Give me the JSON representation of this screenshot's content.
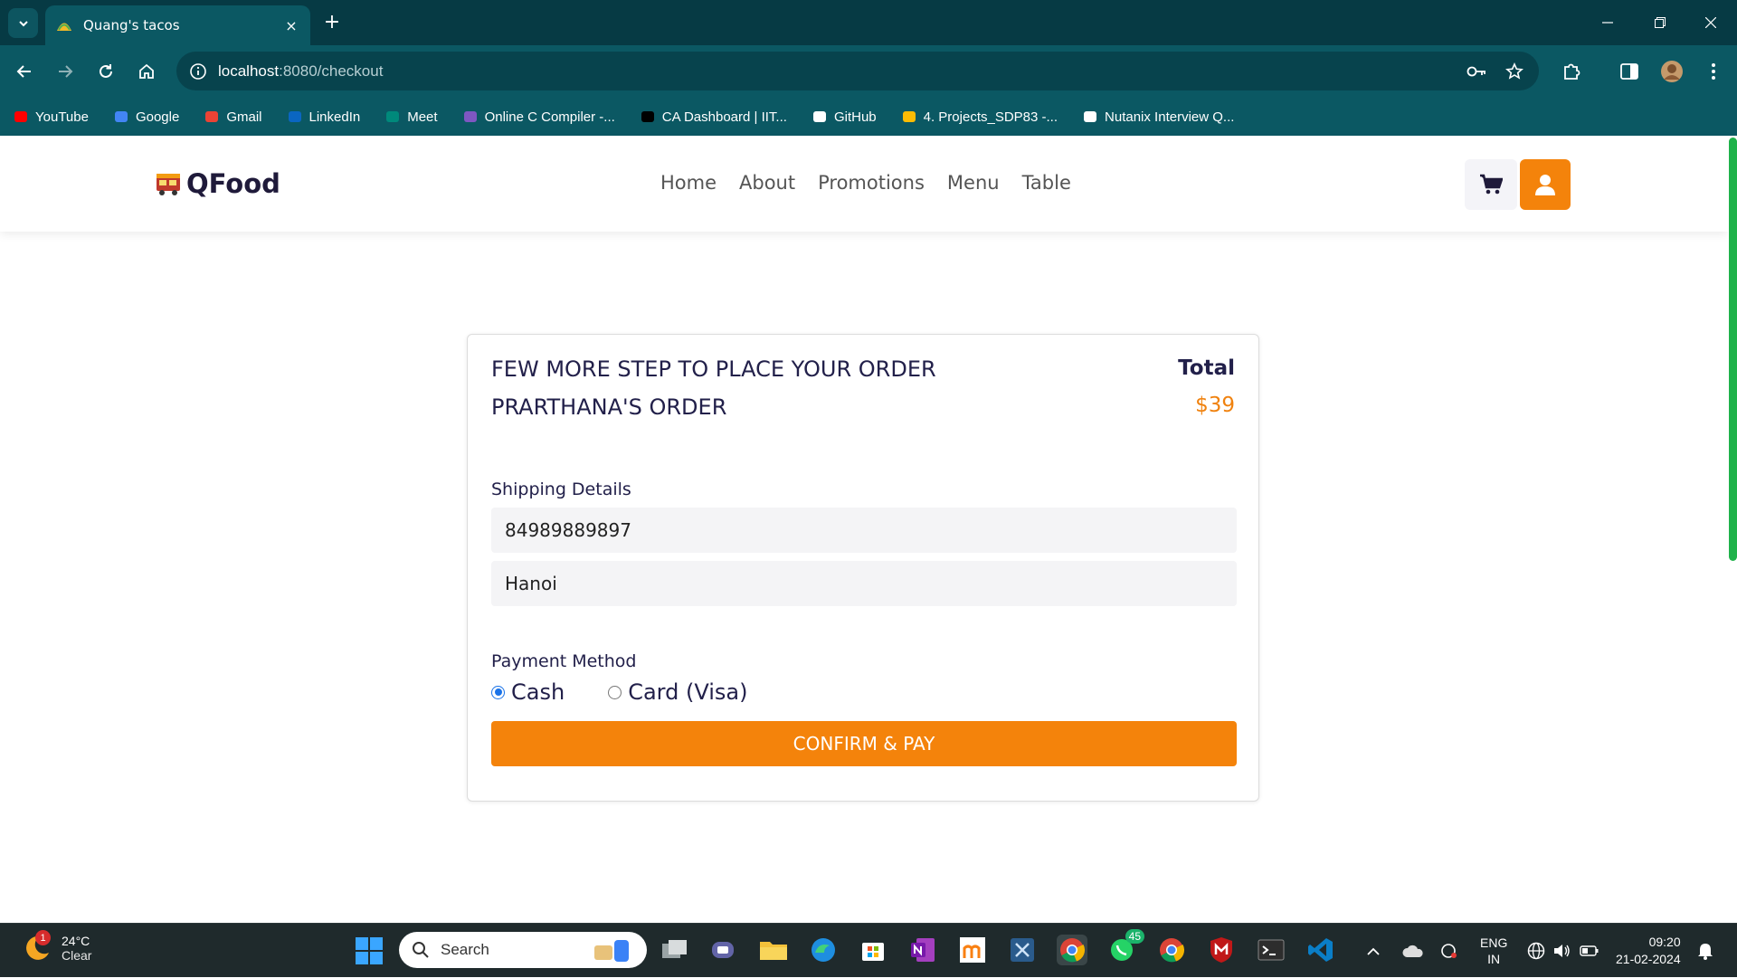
{
  "browser": {
    "tab_title": "Quang's tacos",
    "close_icon": "×",
    "new_tab_icon": "+",
    "url_host": "localhost",
    "url_path": ":8080/checkout",
    "bookmarks": [
      {
        "label": "YouTube",
        "icon": "youtube-icon",
        "color": "#ff0000"
      },
      {
        "label": "Google",
        "icon": "google-icon",
        "color": "#4285f4"
      },
      {
        "label": "Gmail",
        "icon": "gmail-icon",
        "color": "#ea4335"
      },
      {
        "label": "LinkedIn",
        "icon": "linkedin-icon",
        "color": "#0a66c2"
      },
      {
        "label": "Meet",
        "icon": "meet-icon",
        "color": "#00897b"
      },
      {
        "label": "Online C Compiler -...",
        "icon": "bolt-icon",
        "color": "#7e57c2"
      },
      {
        "label": "CA Dashboard | IIT...",
        "icon": "dashboard-icon",
        "color": "#000000"
      },
      {
        "label": "GitHub",
        "icon": "github-icon",
        "color": "#ffffff"
      },
      {
        "label": "4. Projects_SDP83 -...",
        "icon": "drive-icon",
        "color": "#fbbc04"
      },
      {
        "label": "Nutanix Interview Q...",
        "icon": "mountain-icon",
        "color": "#ffffff"
      }
    ]
  },
  "site": {
    "brand": "QFood",
    "nav": [
      "Home",
      "About",
      "Promotions",
      "Menu",
      "Table"
    ],
    "accent_color": "#f4830b"
  },
  "checkout": {
    "heading": "FEW MORE STEP TO PLACE YOUR ORDER",
    "order_name": "PRARTHANA'S ORDER",
    "total_label": "Total",
    "total_value": "$39",
    "shipping_label": "Shipping Details",
    "phone_value": "84989889897",
    "address_value": "Hanoi",
    "payment_label": "Payment Method",
    "payment_options": [
      {
        "label": "Cash",
        "selected": true
      },
      {
        "label": "Card (Visa)",
        "selected": false
      }
    ],
    "confirm_label": "CONFIRM & PAY"
  },
  "taskbar": {
    "weather_temp": "24°C",
    "weather_desc": "Clear",
    "weather_badge": "1",
    "search_placeholder": "Search",
    "whatsapp_badge": "45",
    "lang_1": "ENG",
    "lang_2": "IN",
    "time": "09:20",
    "date": "21-02-2024"
  }
}
